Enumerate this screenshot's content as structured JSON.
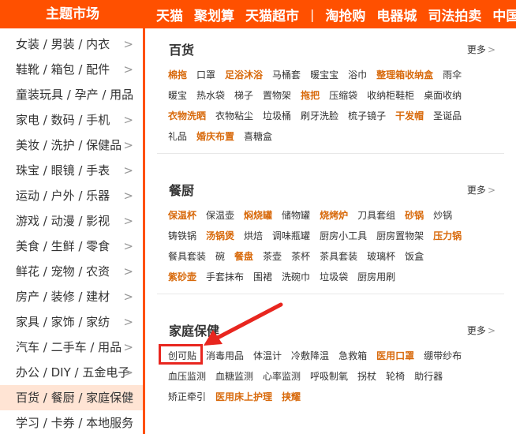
{
  "theme_title": "主题市场",
  "top_nav": [
    "天猫",
    "聚划算",
    "天猫超市",
    "|",
    "淘抢购",
    "电器城",
    "司法拍卖",
    "中国"
  ],
  "sidebar": [
    "女装 / 男装 / 内衣",
    "鞋靴 / 箱包 / 配件",
    "童装玩具 / 孕产 / 用品",
    "家电 / 数码 / 手机",
    "美妆 / 洗护 / 保健品",
    "珠宝 / 眼镜 / 手表",
    "运动 / 户外 / 乐器",
    "游戏 / 动漫 / 影视",
    "美食 / 生鲜 / 零食",
    "鲜花 / 宠物 / 农资",
    "房产 / 装修 / 建材",
    "家具 / 家饰 / 家纺",
    "汽车 / 二手车 / 用品",
    "办公 / DIY / 五金电子",
    "百货 / 餐厨 / 家庭保健",
    "学习 / 卡券 / 本地服务"
  ],
  "sidebar_chevron": ">",
  "more_label": "更多",
  "sections": [
    {
      "title": "百货",
      "rows": [
        [
          {
            "t": "棉拖",
            "h": true
          },
          {
            "t": "口罩",
            "h": false
          },
          {
            "t": "足浴沐浴",
            "h": true
          },
          {
            "t": "马桶套",
            "h": false
          },
          {
            "t": "暖宝宝",
            "h": false
          },
          {
            "t": "浴巾",
            "h": false
          },
          {
            "t": "整理箱收纳盒",
            "h": true
          },
          {
            "t": "雨伞",
            "h": false
          }
        ],
        [
          {
            "t": "暖宝",
            "h": false
          },
          {
            "t": "热水袋",
            "h": false
          },
          {
            "t": "梯子",
            "h": false
          },
          {
            "t": "置物架",
            "h": false
          },
          {
            "t": "拖把",
            "h": true
          },
          {
            "t": "压缩袋",
            "h": false
          },
          {
            "t": "收纳柜鞋柜",
            "h": false
          },
          {
            "t": "桌面收纳",
            "h": false
          }
        ],
        [
          {
            "t": "衣物洗晒",
            "h": true
          },
          {
            "t": "衣物粘尘",
            "h": false
          },
          {
            "t": "垃圾桶",
            "h": false
          },
          {
            "t": "刷牙洗脸",
            "h": false
          },
          {
            "t": "梳子镜子",
            "h": false
          },
          {
            "t": "干发帽",
            "h": true
          },
          {
            "t": "圣诞品",
            "h": false
          }
        ],
        [
          {
            "t": "礼品",
            "h": false
          },
          {
            "t": "婚庆布置",
            "h": true
          },
          {
            "t": "喜糖盒",
            "h": false
          }
        ]
      ]
    },
    {
      "title": "餐厨",
      "rows": [
        [
          {
            "t": "保温杯",
            "h": true
          },
          {
            "t": "保温壶",
            "h": false
          },
          {
            "t": "焖烧罐",
            "h": true
          },
          {
            "t": "储物罐",
            "h": false
          },
          {
            "t": "烧烤炉",
            "h": true
          },
          {
            "t": "刀具套组",
            "h": false
          },
          {
            "t": "砂锅",
            "h": true
          },
          {
            "t": "炒锅",
            "h": false
          }
        ],
        [
          {
            "t": "铸铁锅",
            "h": false
          },
          {
            "t": "汤锅煲",
            "h": true
          },
          {
            "t": "烘焙",
            "h": false
          },
          {
            "t": "调味瓶罐",
            "h": false
          },
          {
            "t": "厨房小工具",
            "h": false
          },
          {
            "t": "厨房置物架",
            "h": false
          },
          {
            "t": "压力锅",
            "h": true
          }
        ],
        [
          {
            "t": "餐具套装",
            "h": false
          },
          {
            "t": "碗",
            "h": false
          },
          {
            "t": "餐盘",
            "h": true
          },
          {
            "t": "茶壶",
            "h": false
          },
          {
            "t": "茶杯",
            "h": false
          },
          {
            "t": "茶具套装",
            "h": false
          },
          {
            "t": "玻璃杯",
            "h": false
          },
          {
            "t": "饭盒",
            "h": false
          }
        ],
        [
          {
            "t": "紫砂壶",
            "h": true
          },
          {
            "t": "手套抹布",
            "h": false
          },
          {
            "t": "围裙",
            "h": false
          },
          {
            "t": "洗碗巾",
            "h": false
          },
          {
            "t": "垃圾袋",
            "h": false
          },
          {
            "t": "厨房用刷",
            "h": false
          }
        ]
      ]
    },
    {
      "title": "家庭保健",
      "rows": [
        [
          {
            "t": "创可贴",
            "h": false
          },
          {
            "t": "消毒用品",
            "h": false
          },
          {
            "t": "体温计",
            "h": false
          },
          {
            "t": "冷敷降温",
            "h": false
          },
          {
            "t": "急救箱",
            "h": false
          },
          {
            "t": "医用口罩",
            "h": true
          },
          {
            "t": "绷带纱布",
            "h": false
          }
        ],
        [
          {
            "t": "血压监测",
            "h": false
          },
          {
            "t": "血糖监测",
            "h": false
          },
          {
            "t": "心率监测",
            "h": false
          },
          {
            "t": "呼吸制氧",
            "h": false
          },
          {
            "t": "拐杖",
            "h": false
          },
          {
            "t": "轮椅",
            "h": false
          },
          {
            "t": "助行器",
            "h": false
          }
        ],
        [
          {
            "t": "矫正牵引",
            "h": false
          },
          {
            "t": "医用床上护理",
            "h": true
          },
          {
            "t": "挟耀",
            "h": true
          }
        ]
      ]
    }
  ],
  "colors": {
    "brand": "#ff5000",
    "highlight_text": "#d86a0c",
    "annotation": "#e8261f"
  }
}
